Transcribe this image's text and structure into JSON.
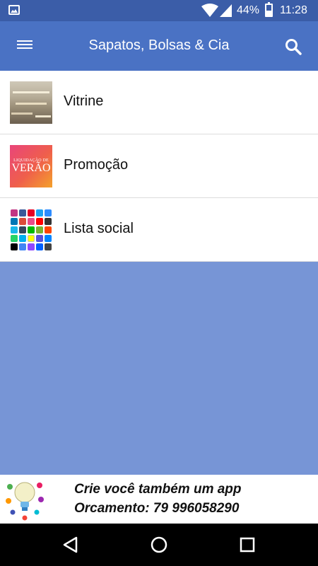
{
  "status_bar": {
    "battery_percent": "44%",
    "battery_level": 0.44,
    "time": "11:28"
  },
  "app_bar": {
    "title": "Sapatos, Bolsas & Cia",
    "left_icon": "hamburger-menu-icon",
    "right_icon": "search-icon"
  },
  "menu": {
    "items": [
      {
        "label": "Vitrine",
        "icon": "store-photo-thumbnail"
      },
      {
        "label": "Promoção",
        "icon": "promo-thumbnail",
        "thumb_line1": "LIQUIDAÇÃO DE",
        "thumb_line2": "VERÃO"
      },
      {
        "label": "Lista social",
        "icon": "social-apps-grid-thumbnail"
      }
    ]
  },
  "banner": {
    "line1": "Crie você também um app",
    "line2": "Orcamento: 79 996058290"
  },
  "nav_bar": {
    "buttons": [
      "back-icon",
      "home-icon",
      "recents-icon"
    ]
  },
  "colors": {
    "status_bar": "#3b5da8",
    "app_bar": "#4a72c4",
    "content_background": "#7795d6"
  }
}
